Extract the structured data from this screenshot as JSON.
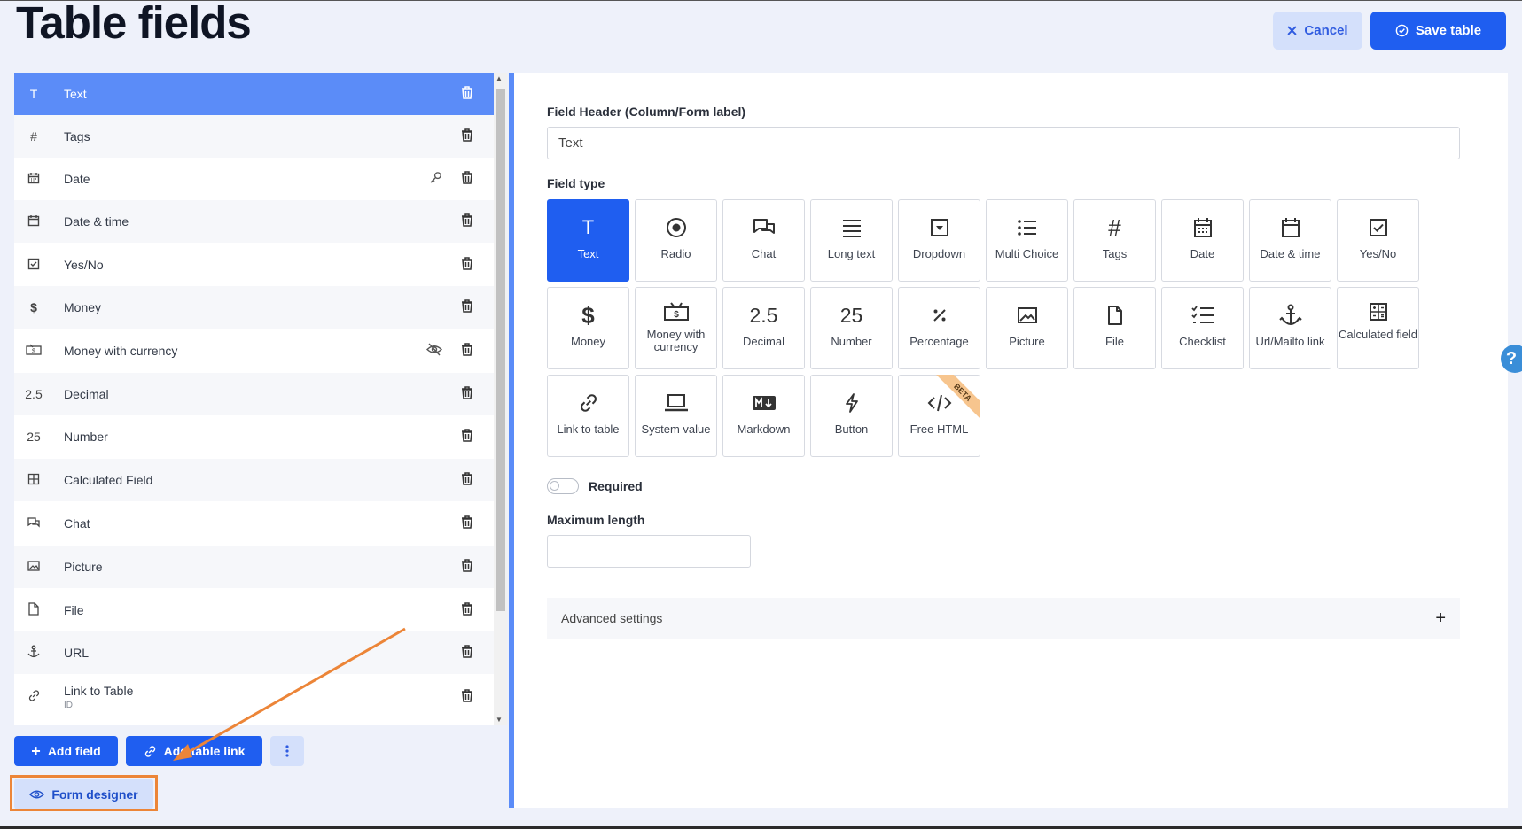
{
  "page": {
    "title": "Table fields"
  },
  "header": {
    "cancel_label": "Cancel",
    "save_label": "Save table"
  },
  "fields_list": [
    {
      "icon": "T",
      "label": "Text"
    },
    {
      "icon": "#",
      "label": "Tags"
    },
    {
      "icon": "calendar",
      "label": "Date"
    },
    {
      "icon": "calendar-blank",
      "label": "Date & time"
    },
    {
      "icon": "checkbox",
      "label": "Yes/No"
    },
    {
      "icon": "$",
      "label": "Money"
    },
    {
      "icon": "money-currency",
      "label": "Money with currency"
    },
    {
      "icon": "2.5",
      "label": "Decimal"
    },
    {
      "icon": "25",
      "label": "Number"
    },
    {
      "icon": "calculator",
      "label": "Calculated Field"
    },
    {
      "icon": "chat",
      "label": "Chat"
    },
    {
      "icon": "picture",
      "label": "Picture"
    },
    {
      "icon": "file",
      "label": "File"
    },
    {
      "icon": "anchor",
      "label": "URL"
    },
    {
      "icon": "link",
      "label": "Link to Table",
      "sub": "ID"
    }
  ],
  "actions": {
    "add_field_label": "Add field",
    "add_table_link_label": "Add table link",
    "form_designer_label": "Form designer"
  },
  "editor": {
    "header_label": "Field Header (Column/Form label)",
    "header_value": "Text",
    "field_type_label": "Field type",
    "required_label": "Required",
    "required_on": false,
    "max_length_label": "Maximum length",
    "max_length_value": "",
    "advanced_label": "Advanced settings"
  },
  "field_types": [
    {
      "label": "Text",
      "icon": "text-T",
      "selected": true
    },
    {
      "label": "Radio",
      "icon": "radio-icon"
    },
    {
      "label": "Chat",
      "icon": "chat-icon"
    },
    {
      "label": "Long text",
      "icon": "lines-icon"
    },
    {
      "label": "Dropdown",
      "icon": "dropdown-icon"
    },
    {
      "label": "Multi Choice",
      "icon": "list-icon"
    },
    {
      "label": "Tags",
      "icon": "hash-icon"
    },
    {
      "label": "Date",
      "icon": "calendar-icon"
    },
    {
      "label": "Date & time",
      "icon": "calendar-blank-icon"
    },
    {
      "label": "Yes/No",
      "icon": "checkbox-icon"
    },
    {
      "label": "Money",
      "icon": "dollar-icon"
    },
    {
      "label": "Money with currency",
      "icon": "money-currency-icon"
    },
    {
      "label": "Decimal",
      "icon": "2.5"
    },
    {
      "label": "Number",
      "icon": "25"
    },
    {
      "label": "Percentage",
      "icon": "percent-icon"
    },
    {
      "label": "Picture",
      "icon": "picture-icon"
    },
    {
      "label": "File",
      "icon": "file-icon"
    },
    {
      "label": "Checklist",
      "icon": "checklist-icon"
    },
    {
      "label": "Url/Mailto link",
      "icon": "anchor-icon"
    },
    {
      "label": "Calculated field",
      "icon": "calculator-icon"
    },
    {
      "label": "Link to table",
      "icon": "link-icon"
    },
    {
      "label": "System value",
      "icon": "laptop-icon"
    },
    {
      "label": "Markdown",
      "icon": "markdown-icon"
    },
    {
      "label": "Button",
      "icon": "lightning-icon"
    },
    {
      "label": "Free HTML",
      "icon": "code-icon",
      "badge": "BETA"
    }
  ],
  "help": {
    "label": "?"
  }
}
